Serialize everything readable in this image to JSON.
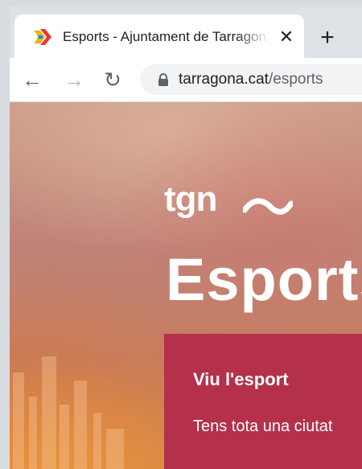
{
  "browser": {
    "tab": {
      "title": "Esports - Ajuntament de Tarragona",
      "close_glyph": "✕",
      "favicon": "tarragona-favicon-icon"
    },
    "new_tab_glyph": "+",
    "nav": {
      "back_glyph": "←",
      "forward_glyph": "→",
      "reload_glyph": "↻"
    },
    "address": {
      "domain": "tarragona.cat",
      "path": "/esports"
    }
  },
  "page": {
    "brand": "tgn",
    "heading": "Esports",
    "card": {
      "title": "Viu l'esport",
      "text": "Tens tota una ciutat"
    }
  },
  "colors": {
    "card": "#b5304b",
    "tab_bg": "#ffffff",
    "tabstrip_bg": "#dee1e6"
  }
}
